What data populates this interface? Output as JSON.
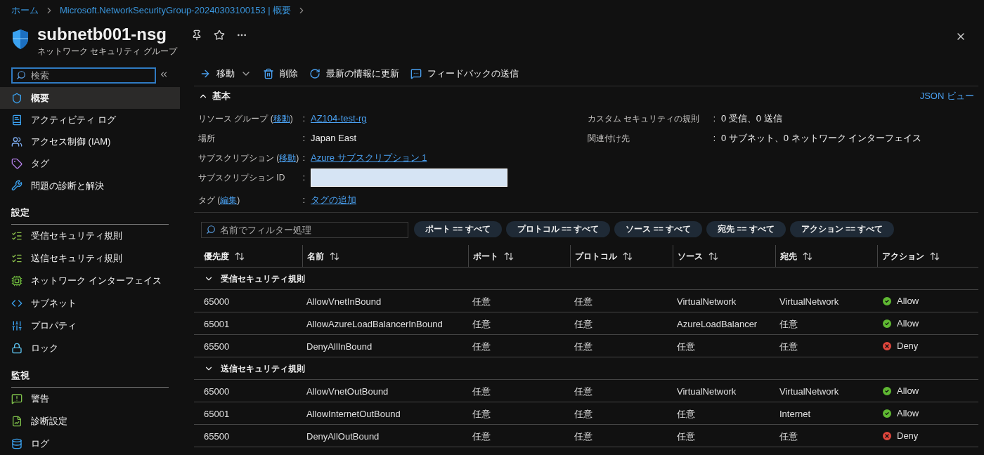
{
  "breadcrumb": [
    {
      "label": "ホーム"
    },
    {
      "label": "Microsoft.NetworkSecurityGroup-20240303100153 | 概要"
    }
  ],
  "header": {
    "title": "subnetb001-nsg",
    "subtitle": "ネットワーク セキュリティ グループ"
  },
  "sidebar": {
    "search": {
      "placeholder": "検索"
    },
    "items": [
      {
        "label": "概要",
        "selected": true
      },
      {
        "label": "アクティビティ ログ",
        "selected": false
      },
      {
        "label": "アクセス制御 (IAM)",
        "selected": false
      },
      {
        "label": "タグ",
        "selected": false
      },
      {
        "label": "問題の診断と解決",
        "selected": false
      }
    ],
    "groups": [
      {
        "heading": "設定",
        "items": [
          {
            "label": "受信セキュリティ規則",
            "selected": false
          },
          {
            "label": "送信セキュリティ規則",
            "selected": false
          },
          {
            "label": "ネットワーク インターフェイス",
            "selected": false
          },
          {
            "label": "サブネット",
            "selected": false
          },
          {
            "label": "プロパティ",
            "selected": false
          },
          {
            "label": "ロック",
            "selected": false
          }
        ]
      },
      {
        "heading": "監視",
        "items": [
          {
            "label": "警告",
            "selected": false
          },
          {
            "label": "診断設定",
            "selected": false
          },
          {
            "label": "ログ",
            "selected": false
          }
        ]
      }
    ]
  },
  "toolbar": [
    {
      "label": "移動",
      "dropdown": true
    },
    {
      "label": "削除",
      "dropdown": false
    },
    {
      "label": "最新の情報に更新",
      "dropdown": false
    },
    {
      "label": "フィードバックの送信",
      "dropdown": false
    }
  ],
  "essentials": {
    "title": "基本",
    "expanded": true,
    "json_view": "JSON ビュー",
    "left": [
      {
        "label": "リソース グループ (",
        "link": "移動",
        "label_tail": ")",
        "sep": ":",
        "kind": "link",
        "value": "AZ104-test-rg"
      },
      {
        "label": "場所",
        "sep": ":",
        "kind": "text",
        "value": "Japan East"
      },
      {
        "label": "サブスクリプション (",
        "link": "移動",
        "label_tail": ")",
        "sep": ":",
        "kind": "link",
        "value": "Azure サブスクリプション 1"
      },
      {
        "label": "サブスクリプション ID",
        "sep": ":",
        "kind": "redacted"
      },
      {
        "label": "タグ (",
        "link": "編集",
        "label_tail": ")",
        "sep": ":",
        "kind": "link",
        "value": "タグの追加"
      }
    ],
    "right": [
      {
        "label": "カスタム セキュリティの規則",
        "sep": ":",
        "kind": "text",
        "value": "0 受信、0 送信"
      },
      {
        "label": "関連付け先",
        "sep": ":",
        "kind": "text",
        "value": "0 サブネット、0 ネットワーク インターフェイス"
      }
    ]
  },
  "filter": {
    "placeholder": "名前でフィルター処理",
    "pills": [
      "ポート == すべて",
      "プロトコル == すべて",
      "ソース == すべて",
      "宛先 == すべて",
      "アクション == すべて"
    ]
  },
  "table": {
    "columns": [
      "優先度",
      "名前",
      "ポート",
      "プロトコル",
      "ソース",
      "宛先",
      "アクション"
    ],
    "groups": [
      {
        "title": "受信セキュリティ規則",
        "expanded": true,
        "rows": [
          {
            "cells": [
              "65000",
              "AllowVnetInBound",
              "任意",
              "任意",
              "VirtualNetwork",
              "VirtualNetwork"
            ],
            "action": {
              "label": "Allow",
              "kind": "allow"
            }
          },
          {
            "cells": [
              "65001",
              "AllowAzureLoadBalancerInBound",
              "任意",
              "任意",
              "AzureLoadBalancer",
              "任意"
            ],
            "action": {
              "label": "Allow",
              "kind": "allow"
            }
          },
          {
            "cells": [
              "65500",
              "DenyAllInBound",
              "任意",
              "任意",
              "任意",
              "任意"
            ],
            "action": {
              "label": "Deny",
              "kind": "deny"
            }
          }
        ]
      },
      {
        "title": "送信セキュリティ規則",
        "expanded": true,
        "rows": [
          {
            "cells": [
              "65000",
              "AllowVnetOutBound",
              "任意",
              "任意",
              "VirtualNetwork",
              "VirtualNetwork"
            ],
            "action": {
              "label": "Allow",
              "kind": "allow"
            }
          },
          {
            "cells": [
              "65001",
              "AllowInternetOutBound",
              "任意",
              "任意",
              "任意",
              "Internet"
            ],
            "action": {
              "label": "Allow",
              "kind": "allow"
            }
          },
          {
            "cells": [
              "65500",
              "DenyAllOutBound",
              "任意",
              "任意",
              "任意",
              "任意"
            ],
            "action": {
              "label": "Deny",
              "kind": "deny"
            }
          }
        ]
      }
    ]
  }
}
